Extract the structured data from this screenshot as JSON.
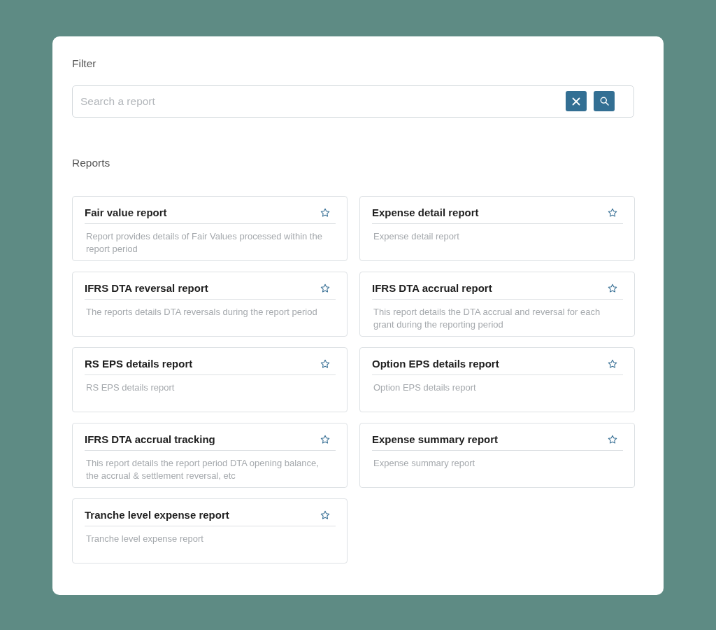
{
  "filter": {
    "heading": "Filter",
    "search": {
      "placeholder": "Search a report"
    }
  },
  "reports": {
    "heading": "Reports",
    "items": [
      {
        "title": "Fair value report",
        "description": "Report provides details of Fair Values processed within the report period",
        "starred": false
      },
      {
        "title": "Expense detail report",
        "description": "Expense detail report",
        "starred": false
      },
      {
        "title": "IFRS DTA reversal report",
        "description": "The reports details DTA reversals during the report period",
        "starred": false
      },
      {
        "title": "IFRS DTA accrual report",
        "description": "This report details the DTA accrual and reversal for each grant during the reporting period",
        "starred": false
      },
      {
        "title": "RS EPS details report",
        "description": "RS EPS details report",
        "starred": false
      },
      {
        "title": "Option EPS details report",
        "description": "Option EPS details report",
        "starred": false
      },
      {
        "title": "IFRS DTA accrual tracking",
        "description": "This report details the report period DTA opening balance, the accrual & settlement reversal, etc",
        "starred": false
      },
      {
        "title": "Expense summary report",
        "description": "Expense summary report",
        "starred": false
      },
      {
        "title": "Tranche level expense report",
        "description": "Tranche level expense report",
        "starred": false
      }
    ]
  }
}
